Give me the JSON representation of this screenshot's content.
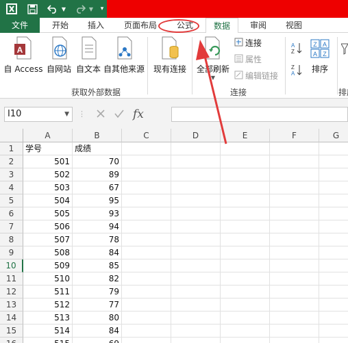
{
  "tabs": {
    "file": "文件",
    "home": "开始",
    "insert": "插入",
    "page_layout": "页面布局",
    "formulas": "公式",
    "data": "数据",
    "review": "审阅",
    "view": "视图"
  },
  "ribbon": {
    "from_access": "自 Access",
    "from_web": "自网站",
    "from_text": "自文本",
    "from_other": "自其他来源",
    "existing_connections": "现有连接",
    "refresh_all": "全部刷新",
    "connections": "连接",
    "properties": "属性",
    "edit_links": "编辑链接",
    "sort": "排序",
    "group_get_external": "获取外部数据",
    "group_connections": "连接",
    "group_sort_partial": "排序"
  },
  "formula_bar": {
    "name_box": "I10",
    "fx": "fx",
    "value": ""
  },
  "columns": [
    "A",
    "B",
    "C",
    "D",
    "E",
    "F",
    "G"
  ],
  "rows": [
    {
      "n": "1",
      "a": "学号",
      "b": "成绩"
    },
    {
      "n": "2",
      "a": "501",
      "b": "70"
    },
    {
      "n": "3",
      "a": "502",
      "b": "89"
    },
    {
      "n": "4",
      "a": "503",
      "b": "67"
    },
    {
      "n": "5",
      "a": "504",
      "b": "95"
    },
    {
      "n": "6",
      "a": "505",
      "b": "93"
    },
    {
      "n": "7",
      "a": "506",
      "b": "94"
    },
    {
      "n": "8",
      "a": "507",
      "b": "78"
    },
    {
      "n": "9",
      "a": "508",
      "b": "84"
    },
    {
      "n": "10",
      "a": "509",
      "b": "85"
    },
    {
      "n": "11",
      "a": "510",
      "b": "82"
    },
    {
      "n": "12",
      "a": "511",
      "b": "79"
    },
    {
      "n": "13",
      "a": "512",
      "b": "77"
    },
    {
      "n": "14",
      "a": "513",
      "b": "80"
    },
    {
      "n": "15",
      "a": "514",
      "b": "84"
    },
    {
      "n": "16",
      "a": "515",
      "b": "69"
    }
  ],
  "colors": {
    "accent": "#217346",
    "annotation": "#e23b3b",
    "title_red_block": "#ee0000"
  }
}
